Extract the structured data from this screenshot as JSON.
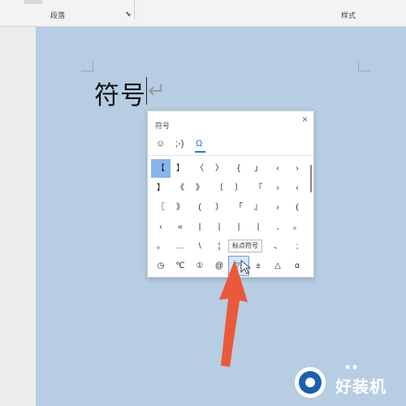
{
  "ribbon": {
    "paragraph_group": "段落",
    "styles_group": "样式"
  },
  "document": {
    "text": "符号",
    "paragraph_mark": "↵"
  },
  "panel": {
    "title": "符号",
    "close": "×",
    "tabs": [
      {
        "label": "☺",
        "icon": "emoji-icon"
      },
      {
        "label": ";-)",
        "icon": "emoticon-icon"
      },
      {
        "label": "Ω",
        "icon": "symbol-icon",
        "active": true
      }
    ],
    "grid": [
      [
        "【",
        "】",
        "〈",
        "〉",
        "{",
        "」",
        "‹",
        "›"
      ],
      [
        "】",
        "《",
        "》",
        "〔",
        "〕",
        "『",
        "›",
        "‹"
      ],
      [
        "〖",
        "》",
        "(",
        "〕",
        "「",
        "』",
        "›",
        "("
      ],
      [
        "‹",
        "«",
        "|",
        "|",
        "|",
        "|",
        ",",
        "。"
      ],
      [
        "。",
        "…",
        "\\",
        "¦",
        "",
        "",
        "、",
        ";"
      ],
      [
        "◷",
        "℃",
        "①",
        "@",
        "?!",
        "±",
        "△",
        "α"
      ]
    ],
    "selected": "【",
    "hovered": "?!"
  },
  "tooltip": {
    "text": "标点符号"
  },
  "watermark": {
    "text": "好装机"
  },
  "colors": {
    "accent": "#2b73d1",
    "selection": "#88b5eb",
    "arrow": "#ea5a3a",
    "page": "#b6cde4"
  }
}
